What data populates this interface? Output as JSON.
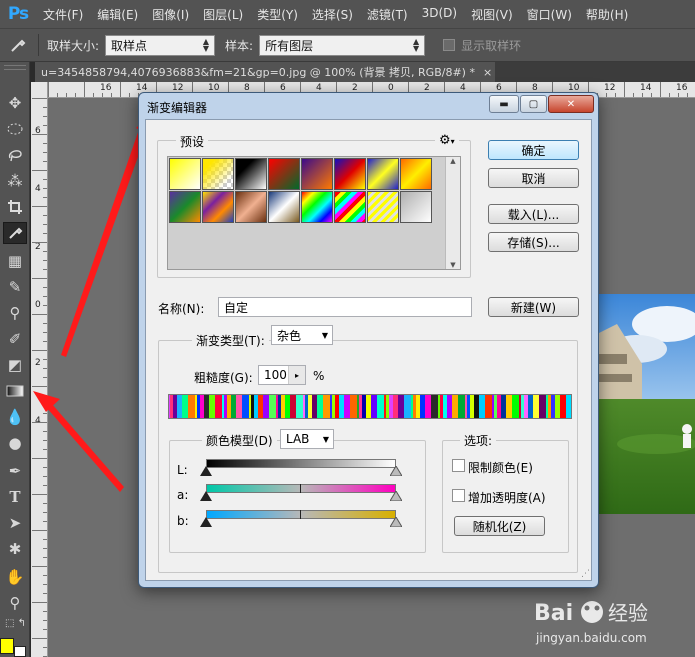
{
  "app": {
    "logo": "Ps"
  },
  "menu": [
    "文件(F)",
    "编辑(E)",
    "图像(I)",
    "图层(L)",
    "类型(Y)",
    "选择(S)",
    "滤镜(T)",
    "3D(D)",
    "视图(V)",
    "窗口(W)",
    "帮助(H)"
  ],
  "options": {
    "sample_size_label": "取样大小:",
    "sample_size_value": "取样点",
    "sample_label": "样本:",
    "sample_value": "所有图层",
    "show_ring_label": "显示取样环"
  },
  "document": {
    "tab_title": "u=3454858794,4076936883&fm=21&gp=0.jpg @ 100% (背景 拷贝, RGB/8#) *",
    "close": "×"
  },
  "rulers": {
    "h_ticks": [
      "16",
      "14",
      "12",
      "10",
      "8",
      "6",
      "4",
      "2",
      "0",
      "2",
      "4",
      "6",
      "8",
      "10",
      "12",
      "14",
      "16",
      "18"
    ],
    "v_ticks": [
      "6",
      "4",
      "2",
      "0",
      "2",
      "4"
    ]
  },
  "dialog": {
    "title": "渐变编辑器",
    "presets_label": "预设",
    "gear": "⚙",
    "buttons": {
      "ok": "确定",
      "cancel": "取消",
      "load": "载入(L)...",
      "save": "存储(S)...",
      "new": "新建(W)"
    },
    "name_label": "名称(N):",
    "name_value": "自定",
    "gradient_type_label": "渐变类型(T):",
    "gradient_type_value": "杂色",
    "roughness_label": "粗糙度(G):",
    "roughness_value": "100",
    "roughness_unit": "%",
    "color_model_label": "颜色模型(D)",
    "color_model_value": "LAB",
    "channels": [
      "L:",
      "a:",
      "b:"
    ],
    "options_label": "选项:",
    "restrict_colors_label": "限制颜色(E)",
    "add_transparency_label": "增加透明度(A)",
    "randomize_label": "随机化(Z)"
  },
  "presets": [
    {
      "name": "yellow-white",
      "css": "linear-gradient(135deg,#ffff00,#ffffff)"
    },
    {
      "name": "yellow-transparent",
      "css": "linear-gradient(135deg,#ffe600 20%,rgba(255,230,0,0) 80%)"
    },
    {
      "name": "black-white",
      "css": "linear-gradient(135deg,#000 30%,#fff)"
    },
    {
      "name": "red-green",
      "css": "linear-gradient(135deg,#ff0000,#006a2a)"
    },
    {
      "name": "violet-orange",
      "css": "linear-gradient(135deg,#3b0b8a,#ff7a00)"
    },
    {
      "name": "blue-red-yellow",
      "css": "linear-gradient(135deg,#1010c0,#e00000 50%,#ffff00)"
    },
    {
      "name": "blue-yellow-blue",
      "css": "linear-gradient(135deg,#2020d0,#ffff20 50%,#2020d0)"
    },
    {
      "name": "orange-yellow-orange",
      "css": "linear-gradient(135deg,#ff6a00,#ffee00 50%,#ff6a00)"
    },
    {
      "name": "violet-green-orange",
      "css": "linear-gradient(135deg,#5a2fa0,#1a8a2a 50%,#ff8a00)"
    },
    {
      "name": "yellow-violet-orange-blue",
      "css": "linear-gradient(135deg,#ffe000,#7a20a0 35%,#ff8a00 65%,#2040c0)"
    },
    {
      "name": "copper",
      "css": "linear-gradient(135deg,#6a3010,#f0b090 50%,#6a3010)"
    },
    {
      "name": "chrome",
      "css": "linear-gradient(135deg,#1a3a7a,#ffffff 50%,#7a5a20)"
    },
    {
      "name": "spectrum",
      "css": "linear-gradient(135deg,#ff0000,#ffff00,#00ff00,#00ffff,#0000ff,#ff00ff)"
    },
    {
      "name": "transparent-rainbow",
      "css": "repeating-linear-gradient(135deg,#ff0000 0 4px,#ffff00 4px 8px,#00ff00 8px 12px,#00ffff 12px 16px,#ff00ff 16px 20px)"
    },
    {
      "name": "transparent-stripes",
      "css": "repeating-linear-gradient(135deg,#ffff00 0 3px,#e0e0e0 3px 6px)"
    },
    {
      "name": "neutral-density",
      "css": "linear-gradient(135deg,#b0b0b0,#ffffff)"
    }
  ],
  "noise_colors": [
    "#e040ff",
    "#ff2f7a",
    "#6a0099",
    "#1ab2ff",
    "#00ff8a",
    "#ff7a00",
    "#ffee00",
    "#0033ff",
    "#ff00cc",
    "#2a2a2a",
    "#66ff00",
    "#ff0040",
    "#00ffee",
    "#aa00ff",
    "#ffaa00",
    "#00aa33",
    "#ff55aa",
    "#004dff",
    "#d4ff00",
    "#111111",
    "#00ccff",
    "#ff3300",
    "#9900ff",
    "#55ff55",
    "#ff0099",
    "#003399",
    "#ffcc00",
    "#00ff00",
    "#cc0033",
    "#33ffcc",
    "#ff66ff",
    "#0066cc",
    "#ffff33",
    "#660066",
    "#00ff99",
    "#ff9900",
    "#3333ff",
    "#99ff00",
    "#ff0000",
    "#00ddff",
    "#cc00ff",
    "#ff6600",
    "#22aa22",
    "#ff3399",
    "#0000aa",
    "#eeff00",
    "#6600ff",
    "#00ffcc",
    "#ff1111",
    "#88ff00"
  ]
}
